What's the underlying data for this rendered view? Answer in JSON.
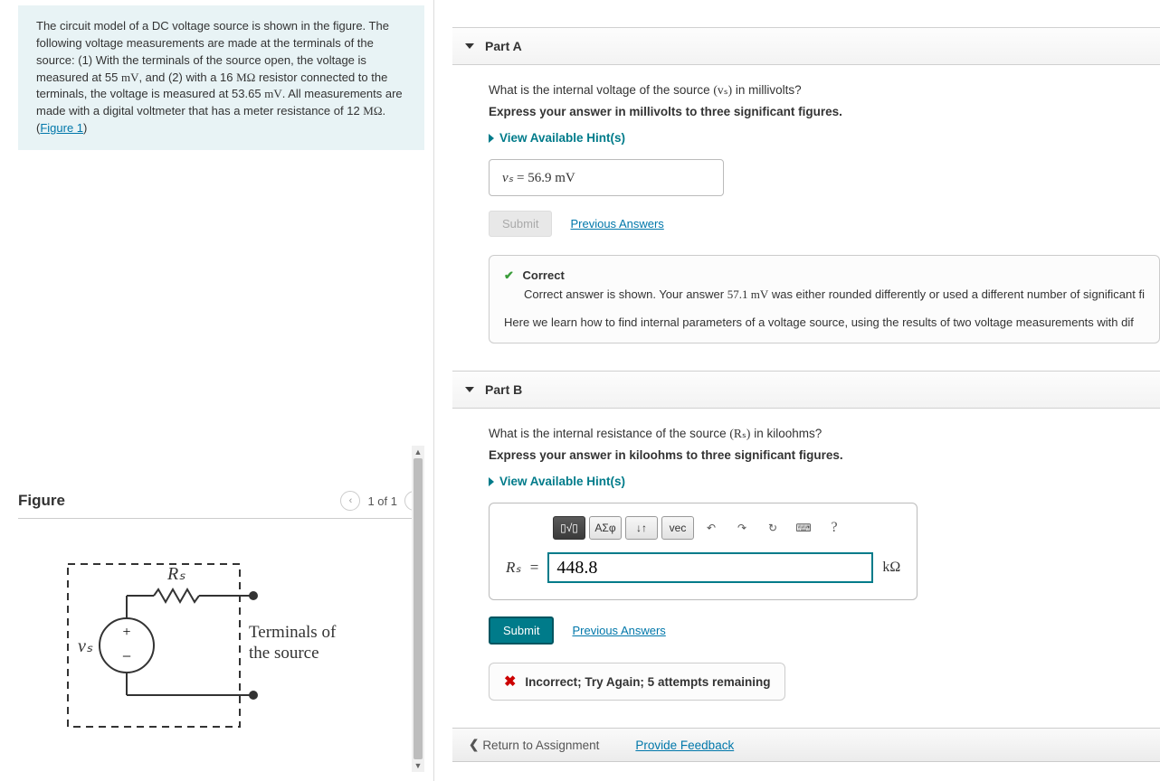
{
  "problem": {
    "text_part1": "The circuit model of a DC voltage source is shown in the figure. The following voltage measurements are made at the terminals of the source: (1) With the terminals of the source open, the voltage is measured at 55 ",
    "unit1": "mV",
    "text_part2": ", and (2) with a 16 ",
    "unit2": "MΩ",
    "text_part3": " resistor connected to the terminals, the voltage is measured at 53.65 ",
    "unit3": "mV",
    "text_part4": ". All measurements are made with a digital voltmeter that has a meter resistance of 12 ",
    "unit4": "MΩ",
    "text_part5": ". (",
    "figure_link": "Figure 1",
    "text_part6": ")"
  },
  "figure": {
    "title": "Figure",
    "counter": "1 of 1",
    "rs_label": "Rₛ",
    "vs_label": "vₛ",
    "terminals_label1": "Terminals of",
    "terminals_label2": "the source",
    "plus": "+",
    "minus": "−"
  },
  "partA": {
    "title": "Part A",
    "question_prefix": "What is the internal voltage of the source ",
    "question_var": "(vₛ)",
    "question_suffix": " in millivolts?",
    "instruction": "Express your answer in millivolts to three significant figures.",
    "hints": "View Available Hint(s)",
    "answer_var": "vₛ",
    "answer_eq": " = ",
    "answer_val": "56.9",
    "answer_unit": " mV",
    "submit": "Submit",
    "previous": "Previous Answers",
    "feedback": {
      "title": "Correct",
      "text_before": "Correct answer is shown. Your answer ",
      "your_answer": "57.1 mV",
      "text_after": " was either rounded differently or used a different number of significant fi",
      "note": "Here we learn how to find internal parameters of a voltage source, using the results of two voltage measurements with dif"
    }
  },
  "partB": {
    "title": "Part B",
    "question_prefix": "What is the internal resistance of the source ",
    "question_var": "(Rₛ)",
    "question_suffix": " in kiloohms?",
    "instruction": "Express your answer in kiloohms to three significant figures.",
    "hints": "View Available Hint(s)",
    "toolbar": {
      "templates": "▯√▯",
      "greek": "ΑΣφ",
      "subsup": "↓↑",
      "vec": "vec",
      "undo": "↶",
      "redo": "↷",
      "reset": "↻",
      "keyboard": "⌨",
      "help": "?"
    },
    "answer_var": "Rₛ",
    "answer_eq": " = ",
    "input_value": "448.8",
    "input_unit": "kΩ",
    "submit": "Submit",
    "previous": "Previous Answers",
    "feedback": {
      "msg": "Incorrect; Try Again; 5 attempts remaining"
    }
  },
  "bottom": {
    "return": "Return to Assignment",
    "feedback": "Provide Feedback"
  }
}
